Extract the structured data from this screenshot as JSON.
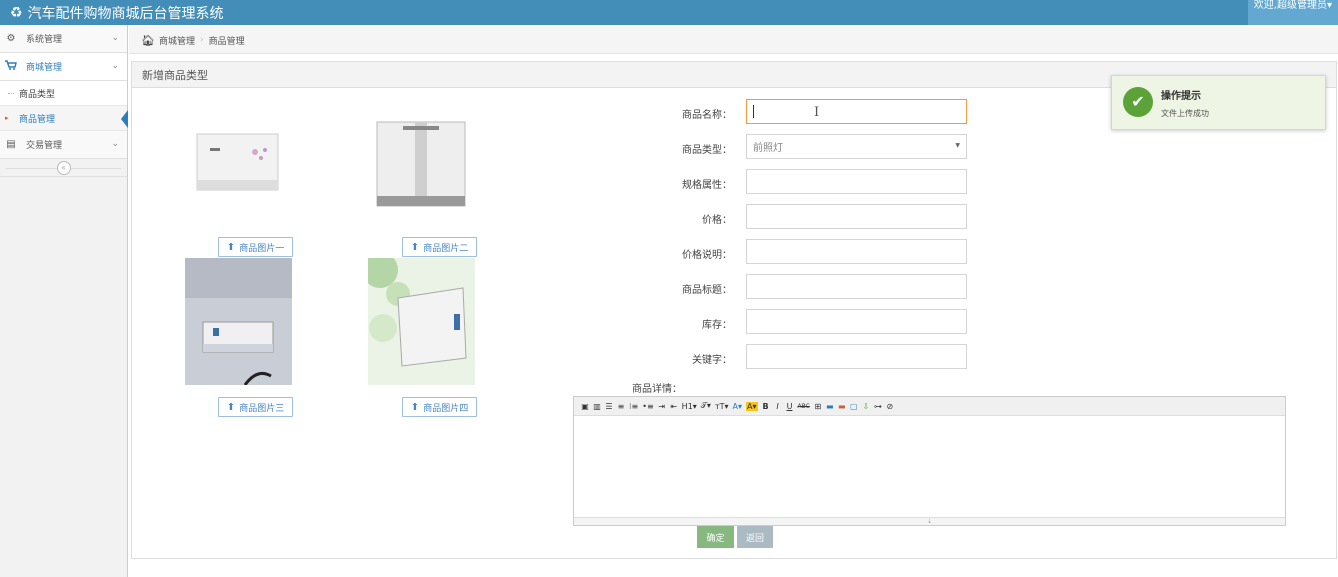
{
  "app": {
    "title": "汽车配件购物商城后台管理系统",
    "user_label": "欢迎,超级管理员▾",
    "logo_icon": "recycle-icon"
  },
  "sidebar": {
    "items": [
      {
        "label": "系统管理",
        "icon": "gears-icon"
      },
      {
        "label": "商城管理",
        "icon": "cart-icon",
        "active": true
      },
      {
        "label": "交易管理",
        "icon": "list-icon"
      }
    ],
    "sub_items": [
      {
        "label": "商品类型"
      },
      {
        "label": "商品管理",
        "selected": true
      }
    ],
    "collapse_glyph": "«"
  },
  "breadcrumb": {
    "items": [
      "商城管理",
      "商品管理"
    ]
  },
  "panel": {
    "title": "新增商品类型"
  },
  "images": {
    "buttons": [
      "商品图片一",
      "商品图片二",
      "商品图片三",
      "商品图片四"
    ]
  },
  "form": {
    "labels": {
      "name": "商品名称：",
      "type": "商品类型：",
      "spec": "规格属性：",
      "price": "价格：",
      "price_note": "价格说明：",
      "title": "商品标题：",
      "stock": "库存：",
      "keywords": "关键字：",
      "detail": "商品详情："
    },
    "values": {
      "name": "",
      "type_selected": "前照灯",
      "spec": "",
      "price": "",
      "price_note": "",
      "title": "",
      "stock": "",
      "keywords": ""
    }
  },
  "editor": {
    "toolbar": [
      "H1▾",
      "𝒯▾",
      "тT▾",
      "A▾",
      "A▾",
      "B",
      "I",
      "U",
      "ABC"
    ],
    "resize_glyph": "⇣"
  },
  "actions": {
    "confirm": "确定",
    "back": "返回"
  },
  "toast": {
    "title": "操作提示",
    "message": "文件上传成功"
  },
  "colors": {
    "topbar": "#438eb9",
    "confirm": "#87b87f",
    "back": "#abbac3",
    "toast_check": "#5ba339"
  }
}
